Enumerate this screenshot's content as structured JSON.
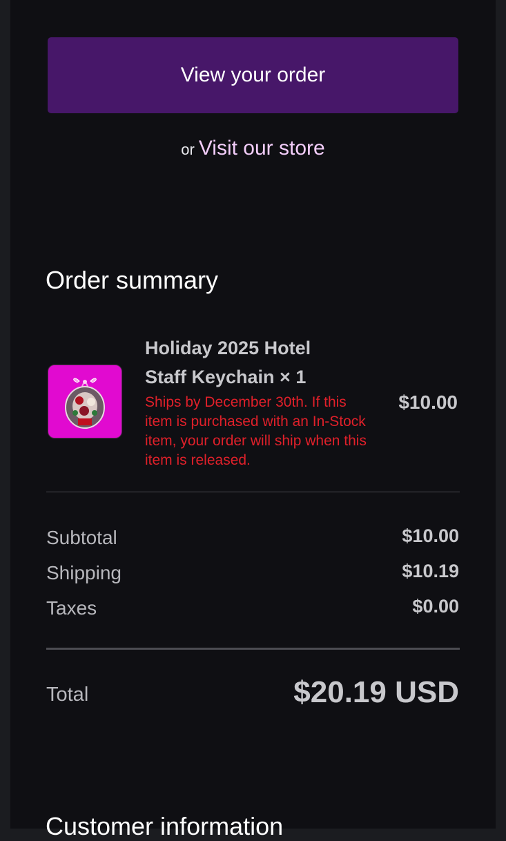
{
  "actions": {
    "view_order_label": "View your order",
    "or_text": "or",
    "visit_store_label": "Visit our store"
  },
  "order_summary": {
    "title": "Order summary",
    "item": {
      "name": "Holiday 2025 Hotel Staff Keychain × 1",
      "note": "Ships by December 30th. If this item is purchased with an In-Stock item, your order will ship when this item is released.",
      "price": "$10.00",
      "image_icon": "keychain-product-image"
    },
    "rows": [
      {
        "label": "Subtotal",
        "value": "$10.00"
      },
      {
        "label": "Shipping",
        "value": "$10.19"
      },
      {
        "label": "Taxes",
        "value": "$0.00"
      }
    ],
    "total_label": "Total",
    "total_value": "$20.19 USD"
  },
  "next_section_title": "Customer information",
  "colors": {
    "button_bg": "#471769",
    "link": "#f3cdfa",
    "note_red": "#e0202a",
    "thumb_bg": "#e10ad0"
  }
}
